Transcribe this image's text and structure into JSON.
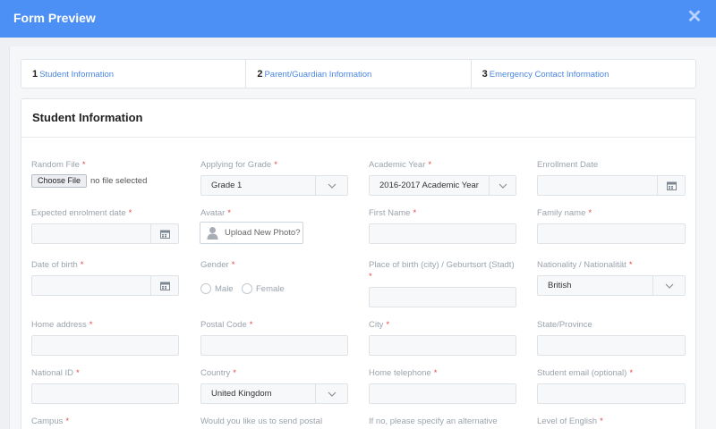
{
  "window": {
    "title": "Form Preview",
    "close_icon": "close-icon"
  },
  "steps": [
    {
      "num": "1",
      "label": "Student Information"
    },
    {
      "num": "2",
      "label": "Parent/Guardian Information"
    },
    {
      "num": "3",
      "label": "Emergency Contact Information"
    }
  ],
  "panel": {
    "title": "Student Information"
  },
  "required_mark": "*",
  "fields": {
    "random_file": {
      "label": "Random File",
      "button": "Choose File",
      "status": "no file selected"
    },
    "applying_grade": {
      "label": "Applying for Grade",
      "value": "Grade 1"
    },
    "academic_year": {
      "label": "Academic Year",
      "value": "2016-2017 Academic Year"
    },
    "enrollment_date": {
      "label": "Enrollment Date"
    },
    "expected_enrolment": {
      "label": "Expected enrolment date"
    },
    "avatar": {
      "label": "Avatar",
      "button": "Upload New Photo?"
    },
    "first_name": {
      "label": "First Name"
    },
    "family_name": {
      "label": "Family name"
    },
    "dob": {
      "label": "Date of birth"
    },
    "gender": {
      "label": "Gender",
      "options": [
        "Male",
        "Female"
      ]
    },
    "place_of_birth": {
      "label": "Place of birth (city) / Geburtsort (Stadt)"
    },
    "nationality": {
      "label": "Nationality / Nationalität",
      "value": "British"
    },
    "home_address": {
      "label": "Home address"
    },
    "postal_code": {
      "label": "Postal Code"
    },
    "city": {
      "label": "City"
    },
    "state": {
      "label": "State/Province"
    },
    "national_id": {
      "label": "National ID"
    },
    "country": {
      "label": "Country",
      "value": "United Kingdom"
    },
    "home_telephone": {
      "label": "Home telephone"
    },
    "student_email": {
      "label": "Student email (optional)"
    },
    "campus": {
      "label": "Campus"
    },
    "postal_question": {
      "label": "Would you like us to send postal"
    },
    "alternative": {
      "label": "If no, please specify an alternative"
    },
    "english_level": {
      "label": "Level of English"
    }
  },
  "colors": {
    "header": "#4c8ff5",
    "link": "#4a86e2",
    "required": "#e14b4b",
    "label": "#9aa3ad"
  }
}
